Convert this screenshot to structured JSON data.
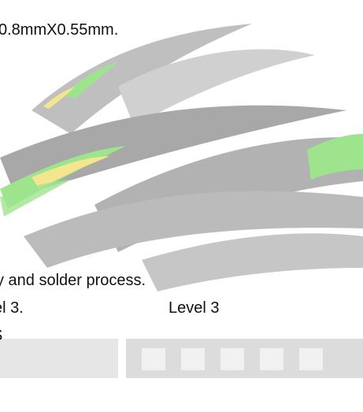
{
  "text": {
    "line1": "0.8mmX0.55mm.",
    "line2": "y and solder process.",
    "line3_left": "el 3.",
    "line3_right": "Level 3",
    "line4": "S"
  },
  "colors": {
    "text": "#111111",
    "watermark_gray": "#9a9a9a",
    "watermark_green": "#8ee07a",
    "watermark_yellow": "#f2e27c"
  }
}
